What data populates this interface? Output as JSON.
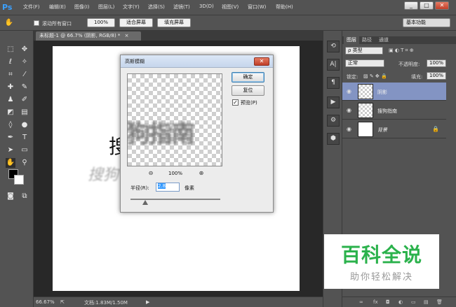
{
  "app": {
    "logo": "Ps"
  },
  "menu": [
    "文件(F)",
    "编辑(E)",
    "图像(I)",
    "图层(L)",
    "文字(Y)",
    "选择(S)",
    "滤镜(T)",
    "3D(D)",
    "视图(V)",
    "窗口(W)",
    "帮助(H)"
  ],
  "window_controls": {
    "minimize": "_",
    "maximize": "□",
    "close": "✕"
  },
  "options": {
    "scroll_all_label": "滚动所有窗口",
    "zoom_value": "100%",
    "fit_screen": "适合屏幕",
    "fill_screen": "填充屏幕",
    "workspace": "基本功能"
  },
  "document": {
    "tab_label": "未标题-1 @ 66.7% (阴影, RGB/8) *",
    "tab_close": "×",
    "zoom": "66.67%",
    "doc_info": "文档:1.83M/1.50M"
  },
  "dialog": {
    "title": "高斯模糊",
    "close": "✕",
    "ok": "确定",
    "reset": "复位",
    "preview_label": "预览(P)",
    "preview_checked": "✓",
    "preview_zoom": "100%",
    "radius_label": "半径(R):",
    "radius_value": "2.8",
    "radius_unit": "像素"
  },
  "layers_panel": {
    "tabs": [
      "图层",
      "路径",
      "通道"
    ],
    "filter_kind": "ρ 类型",
    "blend_mode": "正常",
    "opacity_label": "不透明度:",
    "opacity_value": "100%",
    "lock_label": "锁定:",
    "fill_label": "填充:",
    "fill_value": "100%",
    "layers": [
      {
        "name": "阴影",
        "selected": true
      },
      {
        "name": "搜狗指南",
        "selected": false
      },
      {
        "name": "背景",
        "selected": false
      }
    ],
    "footer_icons": [
      "∞",
      "fx",
      "◘",
      "◐",
      "▭",
      "▤",
      "🗑"
    ]
  },
  "watermark": {
    "title": "百科全说",
    "subtitle": "助你轻松解决"
  },
  "colors": {
    "accent": "#3ba0ff",
    "selected_layer": "#8394c3",
    "watermark_green": "#2bb24c"
  }
}
